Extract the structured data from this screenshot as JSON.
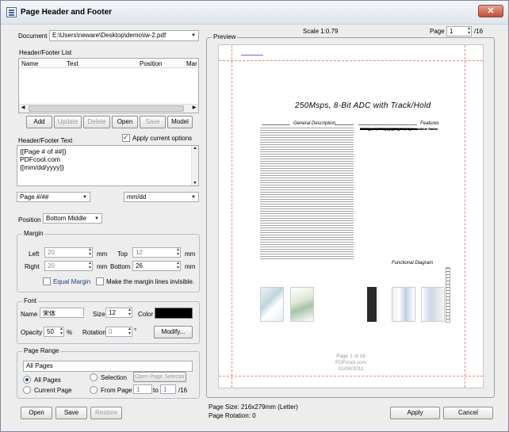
{
  "window": {
    "title": "Page Header and Footer",
    "close_label": "✕"
  },
  "document": {
    "label": "Document",
    "path": "E:\\Users\\neware\\Desktop\\demo\\iw-2.pdf"
  },
  "list": {
    "title": "Header/Footer List",
    "columns": [
      "Name",
      "Text",
      "Position",
      "Mar"
    ]
  },
  "list_buttons": {
    "add": "Add",
    "update": "Update",
    "delete": "Delete",
    "open": "Open",
    "save": "Save",
    "model": "Model"
  },
  "text_section": {
    "label": "Header/Footer Text",
    "apply_current": "Apply current options",
    "content": "{[Page # of ##]}\nPDFcool.com\n{[mm/dd/yyyy]}"
  },
  "format": {
    "page_format": "Page #/##",
    "date_format": "mm/dd"
  },
  "position": {
    "label": "Position",
    "value": "Bottom Middle"
  },
  "margin": {
    "title": "Margin",
    "left_label": "Left",
    "left_value": "20",
    "top_label": "Top",
    "top_value": "12",
    "right_label": "Right",
    "right_value": "20",
    "bottom_label": "Bottom",
    "bottom_value": "26",
    "unit": "mm",
    "equal_margin": "Equal Margin",
    "make_visible": "Make the margin lines invisible."
  },
  "font": {
    "title": "Font",
    "name_label": "Name",
    "name_value": "宋体",
    "size_label": "Size",
    "size_value": "12",
    "color_label": "Color",
    "color_value": "#000000",
    "opacity_label": "Opacity",
    "opacity_value": "50",
    "opacity_unit": "%",
    "rotation_label": "Rotation",
    "rotation_value": "0",
    "rotation_unit": "°",
    "modify_label": "Modify..."
  },
  "range": {
    "title": "Page Range",
    "select_value": "All Pages",
    "all_pages": "All Pages",
    "selection": "Selection",
    "open_selector": "Open Page Selector",
    "current_page": "Current Page",
    "from_page": "From Page",
    "from_value": "1",
    "to_label": "to",
    "to_value": "1",
    "total": "/16"
  },
  "bottom_buttons": {
    "open": "Open",
    "save": "Save",
    "restore": "Restore",
    "apply": "Apply",
    "cancel": "Cancel"
  },
  "preview": {
    "label": "Preview",
    "scale": "Scale 1:0.79",
    "page_label": "Page",
    "page_value": "1",
    "page_total": "/16",
    "page_size": "Page Size: 216x279mm (Letter)",
    "page_rotation": "Page Rotation: 0"
  },
  "pdf": {
    "title": "250Msps, 8-Bit ADC with Track/Hold",
    "general": "General Description",
    "features": "Features",
    "functional": "Functional Diagram",
    "feature_items": [
      "250Msps Conversion Rate",
      "6.0 Effective Bits at 125MHz",
      "Less than ±1/2LSB INL",
      "5V Differential or Single-Ended Inputs",
      "±270mV Input Signal Range",
      "Reference Sense Inputs",
      "Ratiometric Reference Inputs",
      "Configurable Dual-Output Data Paths",
      "Latched, ECL-Compatible Outputs",
      "Low Error Rate, Less than 10^-13 Metastable States",
      "Selectable On-Chip 8:16 Demultiplexer",
      "84-Pin Ceramic Flat Pack",
      "250Msps Conversion Rate",
      "6.0 Effective Bits at 125MHz",
      "Less than ±1/2LSB INL",
      "5V Differential or Single-Ended Inputs",
      "±270mV Input Signal Range",
      "Reference Sense Inputs",
      "Ratiometric Reference Inputs",
      "Configurable Dual-Output Data Paths",
      "Latched, ECL-Compatible Outputs",
      "Low Error Rate, Less than 10^-13 Metastable States",
      "Selectable On-Chip 8:16 Demultiplexer",
      "84-Pin Ceramic Flat Pack"
    ],
    "footer": [
      "Page 1 of 16",
      "PDFcool.com",
      "01/08/2011"
    ]
  }
}
